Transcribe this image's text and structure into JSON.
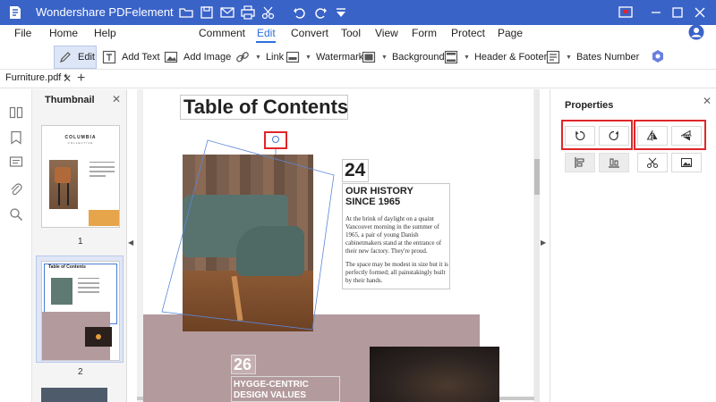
{
  "app": {
    "title": "Wondershare PDFelement",
    "colors": {
      "titlebar": "#3a63c8",
      "accent": "#2f6fde",
      "highlight_box": "#e0262a"
    }
  },
  "menu": {
    "items": [
      "File",
      "Home",
      "Help",
      "Comment",
      "Edit",
      "Convert",
      "Tool",
      "View",
      "Form",
      "Protect",
      "Page"
    ],
    "active": "Edit"
  },
  "toolbar": {
    "edit": "Edit",
    "add_text": "Add Text",
    "add_image": "Add Image",
    "link": "Link",
    "watermark": "Watermark",
    "background": "Background",
    "header_footer": "Header & Footer",
    "bates_number": "Bates Number"
  },
  "tab": {
    "name": "Furniture.pdf *"
  },
  "thumbnail": {
    "title": "Thumbnail",
    "page1": "1",
    "page2": "2",
    "page1_brand": "COLUMBIA",
    "page1_sub": "COLLECTIVE",
    "page2_title": "Table of Contents"
  },
  "document": {
    "toc_title": "Table of Contents",
    "section1_number": "24",
    "section1_title_line1": "OUR HISTORY",
    "section1_title_line2": "SINCE 1965",
    "section1_p1": "At the brink of daylight on a quaint Vancouver morning in the summer of 1965, a pair of young Danish cabinetmakers stand at the entrance of their new factory. They're proud.",
    "section1_p2": "The space may be modest in size but it is perfectly formed; all painstakingly built by their hands.",
    "section2_number": "26",
    "section2_title_line1": "HYGGE-CENTRIC",
    "section2_title_line2": "DESIGN VALUES"
  },
  "properties": {
    "title": "Properties",
    "buttons": [
      "rotate-left-icon",
      "rotate-right-icon",
      "flip-vertical-icon",
      "flip-horizontal-icon",
      "align-bottom-icon",
      "align-left-icon",
      "crop-icon",
      "replace-image-icon"
    ]
  }
}
